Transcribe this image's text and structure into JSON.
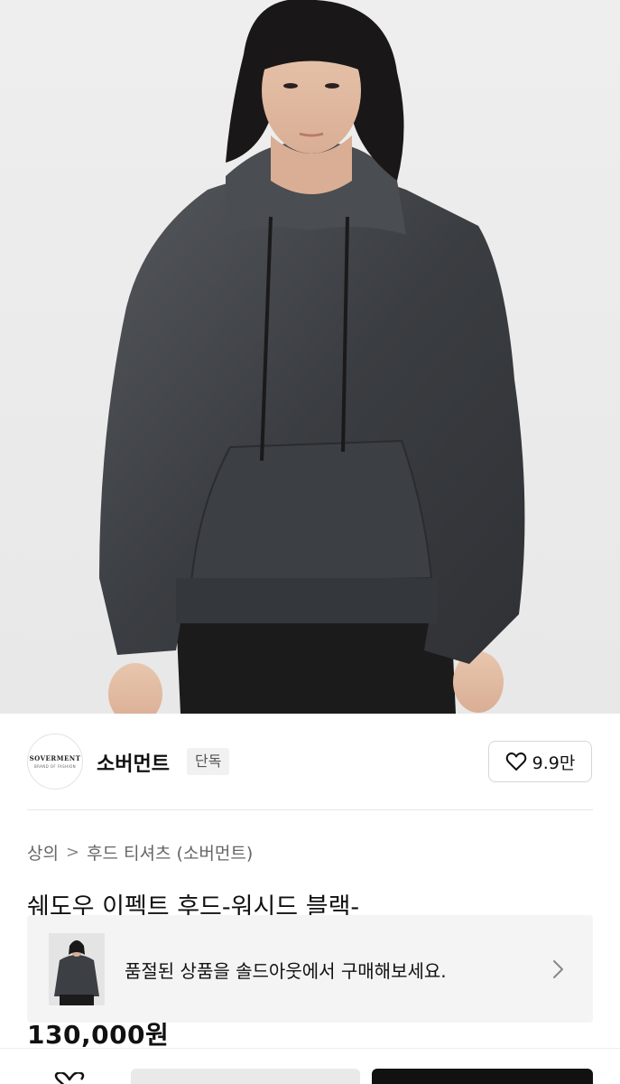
{
  "product_image": {
    "icon": "hoodie-photo"
  },
  "brand": {
    "logo_text": "SOVERMENT",
    "logo_subtext": "BRAND OF FASHION",
    "name": "소버먼트",
    "badge": "단독",
    "likes": "9.9만"
  },
  "breadcrumb": {
    "category": "상의",
    "separator": ">",
    "subcategory": "후드 티셔츠 (소버먼트)"
  },
  "product": {
    "title": "쉐도우 이펙트 후드-워시드 블랙-",
    "price": "130,000원"
  },
  "soldout_banner": {
    "text": "품절된 상품을 솔드아웃에서 구매해보세요."
  },
  "colors": {
    "primary_button": "#111111",
    "secondary_button": "#e9e9e9",
    "banner_bg": "#f4f4f4"
  }
}
